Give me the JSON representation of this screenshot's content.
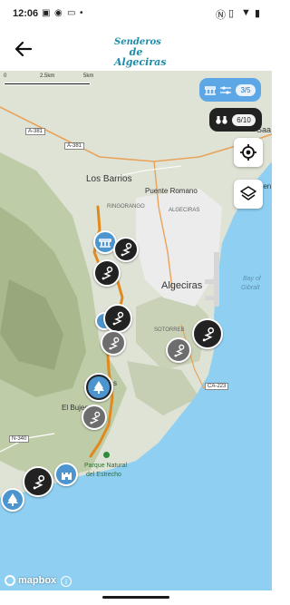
{
  "status": {
    "time": "12:06",
    "right_icons": [
      "nfc-icon",
      "vibrate-icon",
      "wifi-icon",
      "battery-icon"
    ]
  },
  "appbar": {
    "logo_line1": "Senderos",
    "logo_line2": "de Algeciras"
  },
  "map": {
    "scale": {
      "left": "0",
      "mid": "2.5km",
      "right": "5km"
    },
    "filters": {
      "poi_count": "3/5",
      "view_count": "6/10"
    },
    "places": {
      "los_barrios": "Los Barrios",
      "puente_romano": "Puente Romano",
      "ringorango": "RINGORANGO",
      "algeciras_small": "ALGECIRAS",
      "algeciras": "Algeciras",
      "sotorreb": "SOTORREB",
      "bay1": "Bay of",
      "bay2": "Gibralt",
      "el_bujeo": "El Bujeo",
      "saa": "Saa",
      "sen": "Sen",
      "park1": "Parque Natural",
      "park2": "del Estrecho",
      "mark_s": "s"
    },
    "roads": {
      "a381a": "A-381",
      "a381b": "A-381",
      "ca223": "CA-223",
      "n340": "N-340"
    },
    "attribution": "mapbox",
    "colors": {
      "trail": "#e08a1e",
      "water": "#8fd0f2",
      "dark_marker": "#222222",
      "grey_marker": "#6d6d6d",
      "blue_marker": "#4c95cf"
    }
  }
}
